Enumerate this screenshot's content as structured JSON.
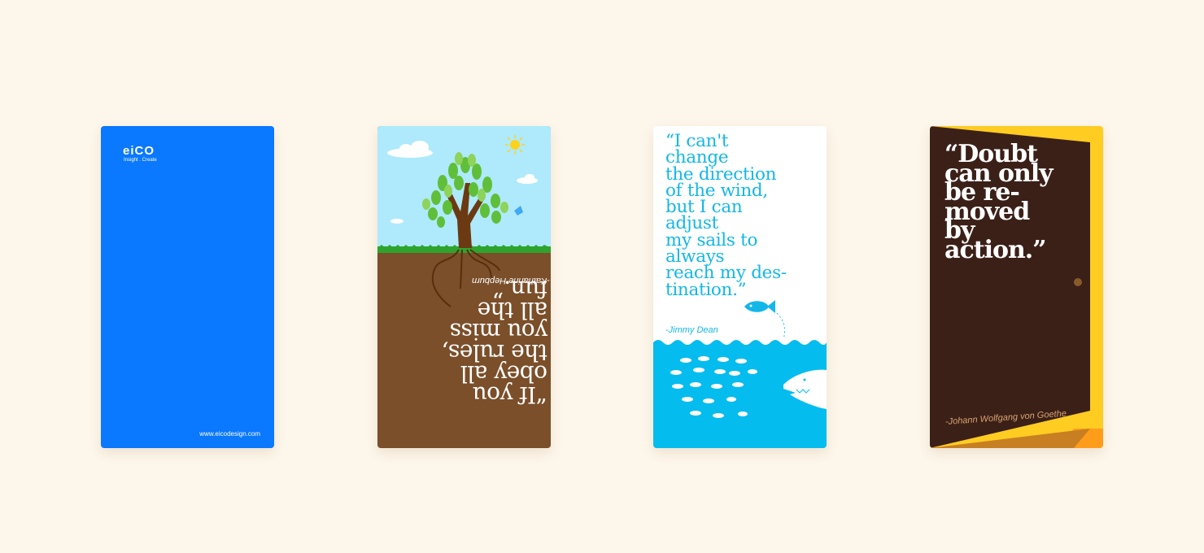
{
  "cards": [
    {
      "logo": "eiCO",
      "tagline": "Insight . Create",
      "url": "www.eicodesign.com",
      "color": "#0a78ff"
    },
    {
      "quote": "“If you obey all the rules, you miss all the fun.”",
      "quote_lines": [
        "“If you",
        "obey all",
        "the rules,",
        "you miss",
        "all the",
        "fun.”"
      ],
      "author": "-Katharine Hepburn",
      "colors": {
        "sky": "#aeeafb",
        "soil": "#7a4f2a",
        "grass": "#2ea42e"
      }
    },
    {
      "quote_lines": [
        "“I can't",
        "change",
        "the direction",
        "of the wind,",
        "but I can",
        "adjust",
        "my sails to",
        "always",
        "reach my des-",
        "tination.”"
      ],
      "author": "-Jimmy Dean",
      "colors": {
        "text": "#12b7e8",
        "sea": "#05bcef"
      }
    },
    {
      "quote_lines": [
        "“Doubt",
        "can only",
        "be re-",
        "moved",
        "by",
        "action.”"
      ],
      "author": "-Johann Wolfgang von Goethe",
      "colors": {
        "door": "#3b2018",
        "frame": "#ffcc22"
      }
    }
  ],
  "background": "#fdf6ea"
}
